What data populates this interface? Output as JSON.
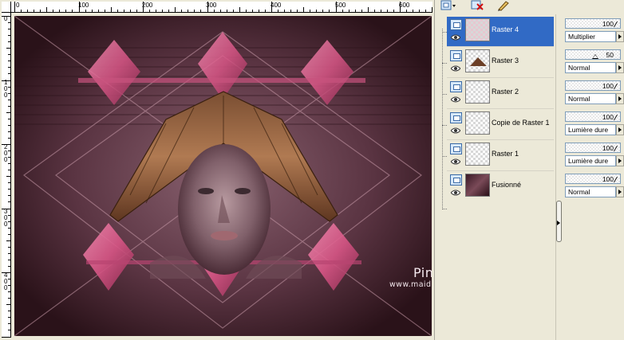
{
  "rulers": {
    "horizontal": [
      "0",
      "100",
      "200",
      "300",
      "400",
      "500",
      "600"
    ],
    "vertical": [
      "0",
      "1\n0\n0",
      "2\n0\n0",
      "3\n0\n0",
      "4\n0\n0"
    ]
  },
  "watermark": {
    "name": "Pinuccia",
    "url": "www.maidiregrafica.eu"
  },
  "toolbar": {
    "icons": [
      "layer-palette-icon",
      "delete-layer-icon",
      "edit-icon"
    ]
  },
  "layers": [
    {
      "name": "Raster 4",
      "selected": true,
      "opacity": "100",
      "blend": "Multiplier"
    },
    {
      "name": "Raster 3",
      "selected": false,
      "opacity": "50",
      "blend": "Normal"
    },
    {
      "name": "Raster 2",
      "selected": false,
      "opacity": "100",
      "blend": "Normal"
    },
    {
      "name": "Copie de Raster 1",
      "selected": false,
      "opacity": "100",
      "blend": "Lumière dure"
    },
    {
      "name": "Raster 1",
      "selected": false,
      "opacity": "100",
      "blend": "Lumière dure"
    },
    {
      "name": "Fusionné",
      "selected": false,
      "opacity": "100",
      "blend": "Normal"
    }
  ],
  "colors": {
    "selection": "#316ac5",
    "image_base": "#3a2029",
    "pink": "#e06a93"
  }
}
